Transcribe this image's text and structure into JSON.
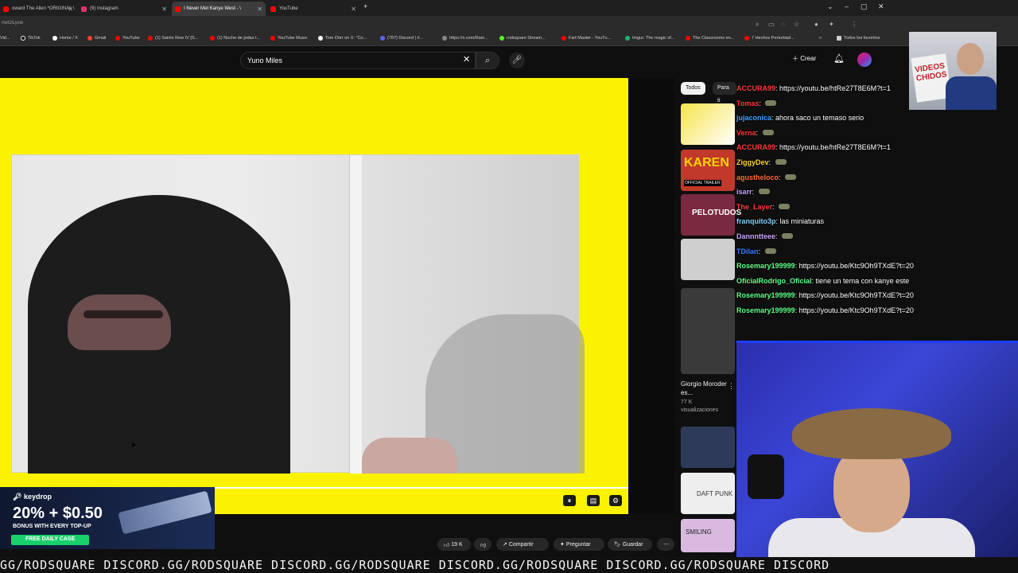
{
  "tabs": [
    {
      "label": "oward The Alien *ORIGINAL \\",
      "color": "#ff0000",
      "active": false
    },
    {
      "label": "(9) Instagram",
      "color": "#e1306c",
      "active": false
    },
    {
      "label": "I Never Met Kanye West - \\",
      "color": "#ff0000",
      "active": true
    },
    {
      "label": "YouTube",
      "color": "#ff0000",
      "active": false
    }
  ],
  "url": "nwIzlLyxw",
  "bookmarks": [
    "Vid...",
    "TikTok",
    "Home / X",
    "Gmail",
    "YouTube",
    "(1) Saints Row IV [S...",
    "(1) Noche de jodas t...",
    "YouTube Music",
    "Tom Dörr on X: \"Co...",
    "(787) Discord | #...",
    "https://x.com/Rain...",
    "rodsquare Stream...",
    "Fart Master - YouTu...",
    "Imgur: The magic of...",
    "The Classrooms en...",
    "7 Hechos Perturbad..."
  ],
  "bookmarks_all": "Todos los favoritos",
  "search": {
    "value": "Yuno Miles"
  },
  "header": {
    "create_label": "Crear"
  },
  "chips": [
    "Todos",
    "Para ti"
  ],
  "ad": {
    "brand": "keydrop",
    "headline": "20% + $0.50",
    "subline": "BONUS WITH EVERY TOP-UP",
    "cta": "FREE DAILY CASE"
  },
  "actions": {
    "likes": "19 K",
    "share": "Compartir",
    "ask": "Preguntar",
    "save": "Guardar"
  },
  "side_video": {
    "title": "Giorgio Moroder es...",
    "views": "77 K",
    "views_label": "visualizaciones"
  },
  "thumbs_text": [
    "KAREN",
    "OFFICIAL TRAILER",
    "PELOTUDOS",
    "DAFT PUNK",
    "SMILING"
  ],
  "chat": [
    {
      "user": "ACCURA99",
      "text": "https://youtu.be/htRe27T8E6M?t=1",
      "color": "#ff3b3b"
    },
    {
      "user": "Tomas",
      "text": "",
      "color": "#ff3b3b",
      "emote": true
    },
    {
      "user": "jujaconica",
      "text": "ahora saco un temaso serio",
      "color": "#3da3ff"
    },
    {
      "user": "Verna",
      "text": "",
      "color": "#ff3b3b",
      "emote": true
    },
    {
      "user": "ACCURA99",
      "text": "https://youtu.be/htRe27T8E6M?t=1",
      "color": "#ff3b3b"
    },
    {
      "user": "ZiggyDev",
      "text": "",
      "color": "#ffd23b",
      "emote": true
    },
    {
      "user": "agustheloco",
      "text": "",
      "color": "#ff6a3b",
      "emote": true
    },
    {
      "user": "isarr",
      "text": "",
      "color": "#c8a0ff",
      "emote": true
    },
    {
      "user": "The_Layer",
      "text": "",
      "color": "#ff3b3b",
      "emote": true
    },
    {
      "user": "franquito3p",
      "text": "las miniaturas",
      "color": "#7fd0ff"
    },
    {
      "user": "Dannntteee",
      "text": "",
      "color": "#c8a0ff",
      "emote": true
    },
    {
      "user": "TDilan",
      "text": "",
      "color": "#3d7bff",
      "emote": true
    },
    {
      "user": "Rosemary199999",
      "text": "https://youtu.be/Ktc9Oh9TXdE?t=20",
      "color": "#5fff8a"
    },
    {
      "user": "OficialRodrigo_Oficial",
      "text": "tiene un tema con kanye este",
      "color": "#5fff8a"
    },
    {
      "user": "Rosemary199999",
      "text": "https://youtu.be/Ktc9Oh9TXdE?t=20",
      "color": "#5fff8a"
    },
    {
      "user": "Rosemary199999",
      "text": "https://youtu.be/Ktc9Oh9TXdE?t=20",
      "color": "#5fff8a"
    }
  ],
  "cam_sign": "VIDEOS CHIDOS",
  "ticker": "GG/RODSQUARE  DISCORD.GG/RODSQUARE  DISCORD.GG/RODSQUARE  DISCORD.GG/RODSQUARE  DISCORD.GG/RODSQUARE  DISCORD",
  "colors": {
    "player_bg": "#fbf200",
    "yt_dark": "#0f0f0f",
    "accent_green": "#18d16c"
  }
}
